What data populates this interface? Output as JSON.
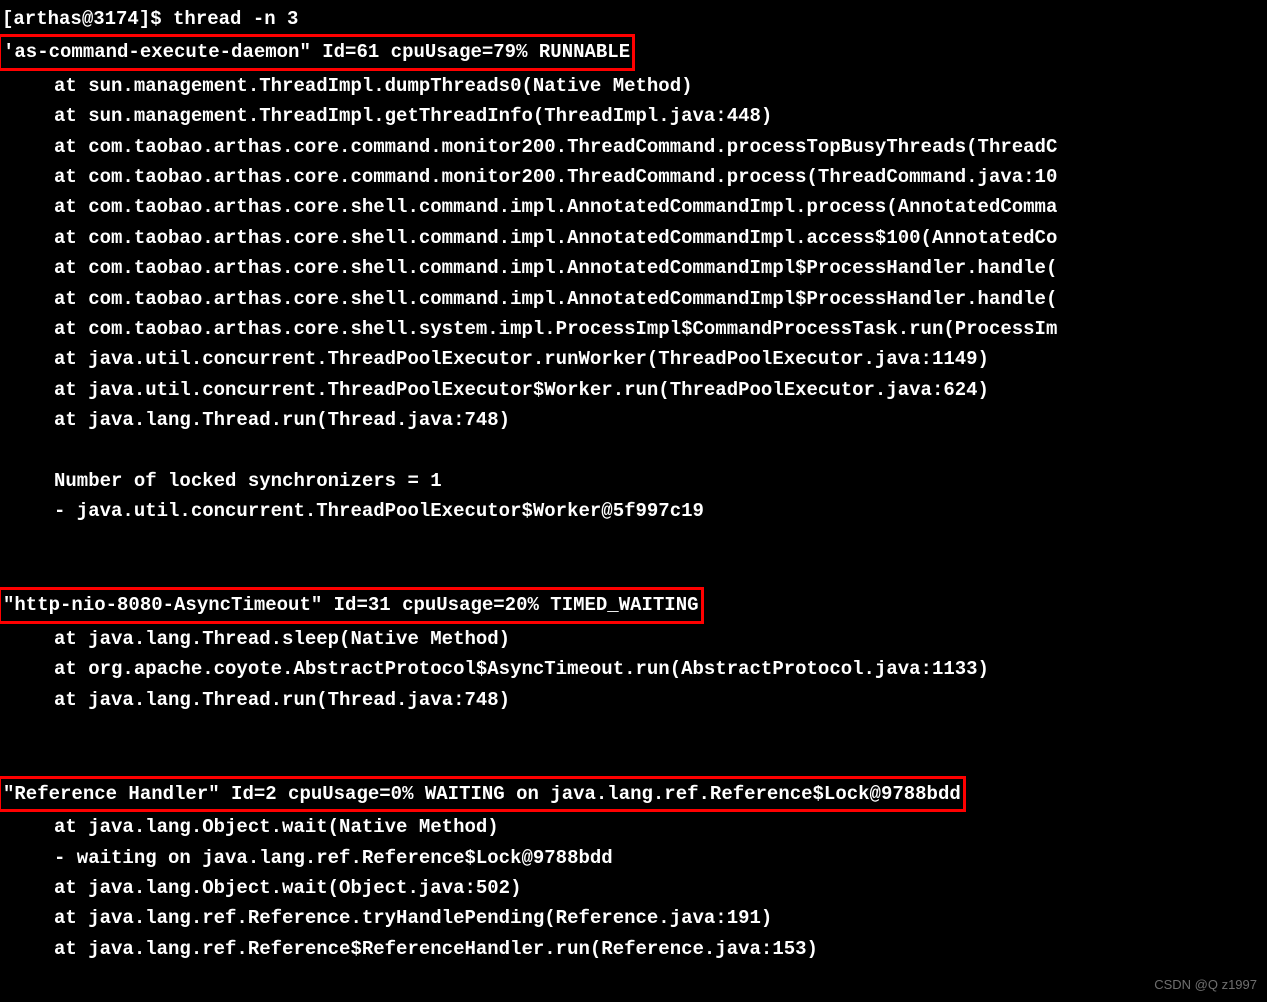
{
  "prompt": "[arthas@3174]$ thread -n 3",
  "threads": [
    {
      "header": "'as-command-execute-daemon\" Id=61 cpuUsage=79% RUNNABLE",
      "stack": [
        "at sun.management.ThreadImpl.dumpThreads0(Native Method)",
        "at sun.management.ThreadImpl.getThreadInfo(ThreadImpl.java:448)",
        "at com.taobao.arthas.core.command.monitor200.ThreadCommand.processTopBusyThreads(ThreadC",
        "at com.taobao.arthas.core.command.monitor200.ThreadCommand.process(ThreadCommand.java:10",
        "at com.taobao.arthas.core.shell.command.impl.AnnotatedCommandImpl.process(AnnotatedComma",
        "at com.taobao.arthas.core.shell.command.impl.AnnotatedCommandImpl.access$100(AnnotatedCo",
        "at com.taobao.arthas.core.shell.command.impl.AnnotatedCommandImpl$ProcessHandler.handle(",
        "at com.taobao.arthas.core.shell.command.impl.AnnotatedCommandImpl$ProcessHandler.handle(",
        "at com.taobao.arthas.core.shell.system.impl.ProcessImpl$CommandProcessTask.run(ProcessIm",
        "at java.util.concurrent.ThreadPoolExecutor.runWorker(ThreadPoolExecutor.java:1149)",
        "at java.util.concurrent.ThreadPoolExecutor$Worker.run(ThreadPoolExecutor.java:624)",
        "at java.lang.Thread.run(Thread.java:748)",
        "",
        "Number of locked synchronizers = 1",
        "- java.util.concurrent.ThreadPoolExecutor$Worker@5f997c19"
      ]
    },
    {
      "header": "\"http-nio-8080-AsyncTimeout\" Id=31 cpuUsage=20% TIMED_WAITING",
      "stack": [
        "at java.lang.Thread.sleep(Native Method)",
        "at org.apache.coyote.AbstractProtocol$AsyncTimeout.run(AbstractProtocol.java:1133)",
        "at java.lang.Thread.run(Thread.java:748)"
      ]
    },
    {
      "header": "\"Reference Handler\" Id=2 cpuUsage=0% WAITING on java.lang.ref.Reference$Lock@9788bdd",
      "stack": [
        "at java.lang.Object.wait(Native Method)",
        "-  waiting on java.lang.ref.Reference$Lock@9788bdd",
        "at java.lang.Object.wait(Object.java:502)",
        "at java.lang.ref.Reference.tryHandlePending(Reference.java:191)",
        "at java.lang.ref.Reference$ReferenceHandler.run(Reference.java:153)"
      ]
    }
  ],
  "watermark": "CSDN @Q z1997"
}
